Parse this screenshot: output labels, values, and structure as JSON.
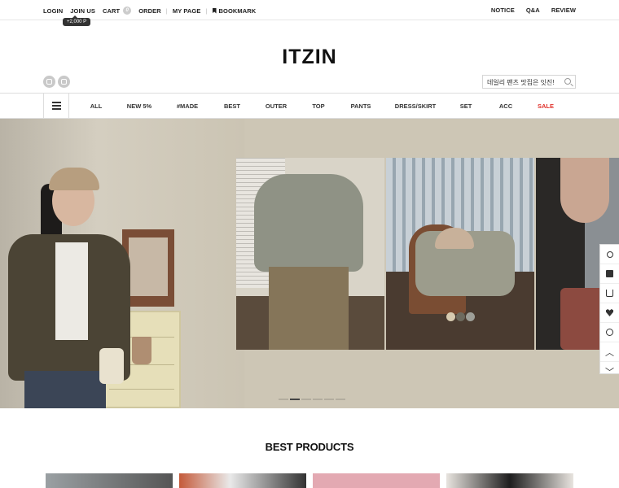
{
  "topbar": {
    "left": [
      "LOGIN",
      "JOIN US",
      "CART",
      "ORDER",
      "MY PAGE",
      "BOOKMARK"
    ],
    "cart_count": "0",
    "separator": "|",
    "right": [
      "NOTICE",
      "Q&A",
      "REVIEW"
    ],
    "point_badge": "+2,000 P"
  },
  "logo": "ITZIN",
  "sns_icons": [
    "instagram-icon",
    "blog-icon"
  ],
  "search": {
    "placeholder": "데일리 팬츠 맛집은 잇진!"
  },
  "category_nav": [
    "ALL",
    "NEW 5%",
    "#MADE",
    "BEST",
    "OUTER",
    "TOP",
    "PANTS",
    "DRESS/SKIRT",
    "SET",
    "ACC",
    "SALE"
  ],
  "colors": {
    "sale": "#e0312b",
    "text": "#222222",
    "hero_bg": "#cdc6b5"
  },
  "hero": {
    "slide_count": 6,
    "active_slide": 2
  },
  "quick_menu": [
    "search-icon",
    "truck-icon",
    "cart-icon",
    "heart-icon",
    "clock-icon",
    "arrow-up-icon",
    "arrow-down-icon"
  ],
  "section_title": "BEST PRODUCTS"
}
